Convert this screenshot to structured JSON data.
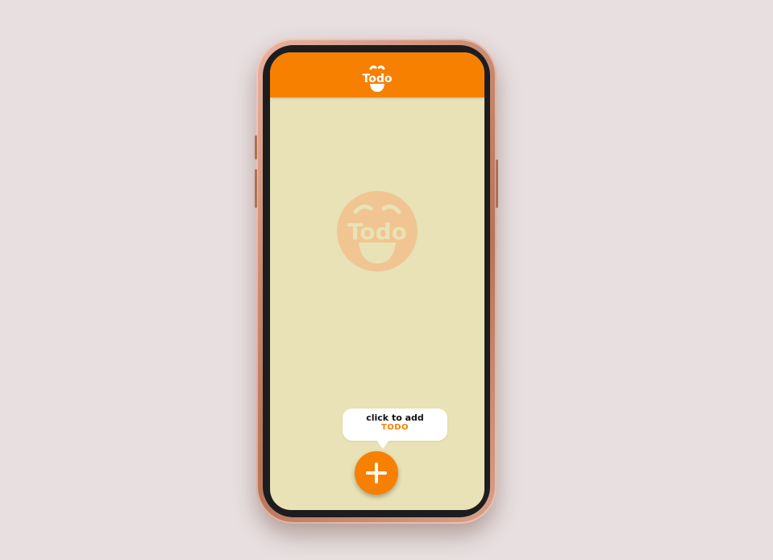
{
  "colors": {
    "accent": "#f78000",
    "screen_background": "#e8e2b6",
    "page_background": "#e8dfe0",
    "watermark": "#f1c591"
  },
  "header": {
    "logo_text": "Todo",
    "logo_icon": "todo-face-logo-icon"
  },
  "empty_state": {
    "watermark_text": "Todo",
    "watermark_icon": "todo-face-watermark-icon"
  },
  "hint": {
    "line1": "click to add",
    "line2": "TODO"
  },
  "fab": {
    "icon": "plus-icon"
  }
}
